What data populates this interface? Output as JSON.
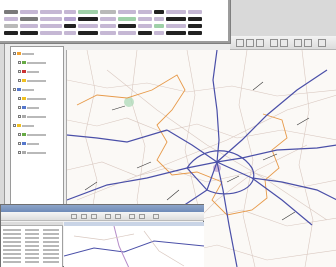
{
  "screen": {
    "description_visible": false
  },
  "attribute_window": {
    "rows": [
      {
        "cells": [
          "#7a7a7a",
          "#c5b7d4",
          "#c5b7d4",
          "#c5b7d4",
          "#9fd0a8",
          "#b9b9b9",
          "#c5b7d4",
          "#c5b7d4",
          "#222222",
          "#c5b7d4",
          "#c5b7d4"
        ]
      },
      {
        "cells": [
          "#c5b7d4",
          "#7a7a7a",
          "#c5b7d4",
          "#b4a3cf",
          "#222222",
          "#c5b7d4",
          "#9fd0a8",
          "#c5b7d4",
          "#c5b7d4",
          "#222222",
          "#222222"
        ]
      },
      {
        "cells": [
          "#b9b9b9",
          "#c5b7d4",
          "#c5b7d4",
          "#222222",
          "#c5b7d4",
          "#c5b7d4",
          "#222222",
          "#c5b7d4",
          "#9fd0a8",
          "#c5b7d4",
          "#222222"
        ]
      },
      {
        "cells": [
          "#222222",
          "#222222",
          "#c5b7d4",
          "#c5b7d4",
          "#222222",
          "#c5b7d4",
          "#c5b7d4",
          "#222222",
          "#c5b7d4",
          "#222222",
          "#222222"
        ]
      }
    ]
  },
  "layer_tree": {
    "items": [
      {
        "swatch": "#f0a030",
        "label": ""
      },
      {
        "swatch": "#66aa44",
        "label": ""
      },
      {
        "swatch": "#cc3333",
        "label": ""
      },
      {
        "swatch": "#f0c020",
        "label": ""
      },
      {
        "swatch": "#5577cc",
        "label": ""
      },
      {
        "swatch": "#f0c020",
        "label": ""
      },
      {
        "swatch": "#5577cc",
        "label": ""
      },
      {
        "swatch": "#aaaaaa",
        "label": ""
      },
      {
        "swatch": "#f0c020",
        "label": ""
      },
      {
        "swatch": "#66aa44",
        "label": ""
      },
      {
        "swatch": "#5577cc",
        "label": ""
      },
      {
        "swatch": "#aaaaaa",
        "label": ""
      }
    ]
  },
  "map": {
    "colors": {
      "background": "#fbf9f6",
      "major_roads": "#4a4fa8",
      "boundary": "#e79a4a",
      "minor_roads": "#d9c8c0",
      "green_area": "#a8d9b5",
      "purple_area": "#b48bc8"
    }
  },
  "second_window": {
    "title_color": "#7a92bd"
  }
}
